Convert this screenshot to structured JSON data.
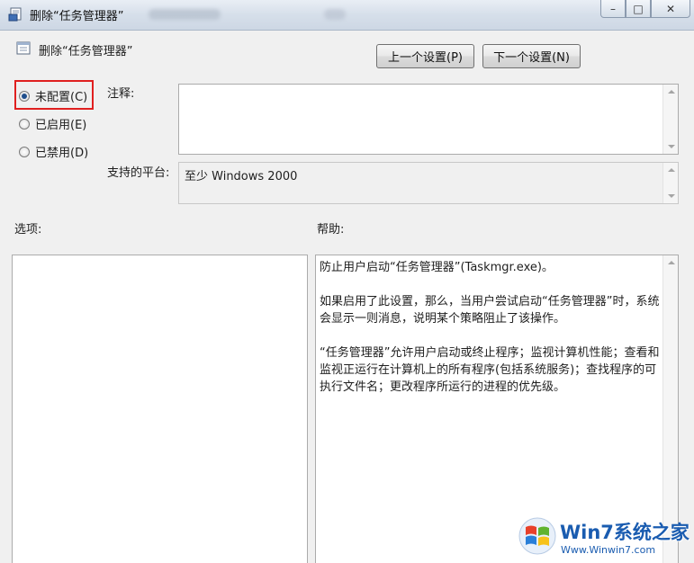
{
  "window": {
    "title": "删除“任务管理器”",
    "buttons": {
      "minimize": "–",
      "maximize": "□",
      "close": "✕"
    }
  },
  "header": {
    "title": "删除“任务管理器”"
  },
  "nav": {
    "prev_label": "上一个设置(P)",
    "next_label": "下一个设置(N)"
  },
  "state_options": [
    {
      "label": "未配置(C)",
      "checked": true
    },
    {
      "label": "已启用(E)",
      "checked": false
    },
    {
      "label": "已禁用(D)",
      "checked": false
    }
  ],
  "comment": {
    "label": "注释:",
    "value": ""
  },
  "platform": {
    "label": "支持的平台:",
    "value": "至少 Windows 2000"
  },
  "options": {
    "label": "选项:"
  },
  "help": {
    "label": "帮助:",
    "paragraphs": [
      "防止用户启动“任务管理器”(Taskmgr.exe)。",
      "如果启用了此设置，那么，当用户尝试启动“任务管理器”时，系统会显示一则消息，说明某个策略阻止了该操作。",
      "“任务管理器”允许用户启动或终止程序；监视计算机性能；查看和监视正运行在计算机上的所有程序(包括系统服务)；查找程序的可执行文件名；更改程序所运行的进程的优先级。"
    ]
  },
  "watermark": {
    "brand": "Win7系统之家",
    "url": "Www.Winwin7.com"
  },
  "colors": {
    "highlight_border": "#e02020",
    "radio_dot": "#1f4e8c",
    "watermark_blue": "#1a5cb0"
  },
  "icons": {
    "window": "policy-document-icon",
    "header": "policy-document-icon",
    "watermark": "windows-logo-icon"
  }
}
